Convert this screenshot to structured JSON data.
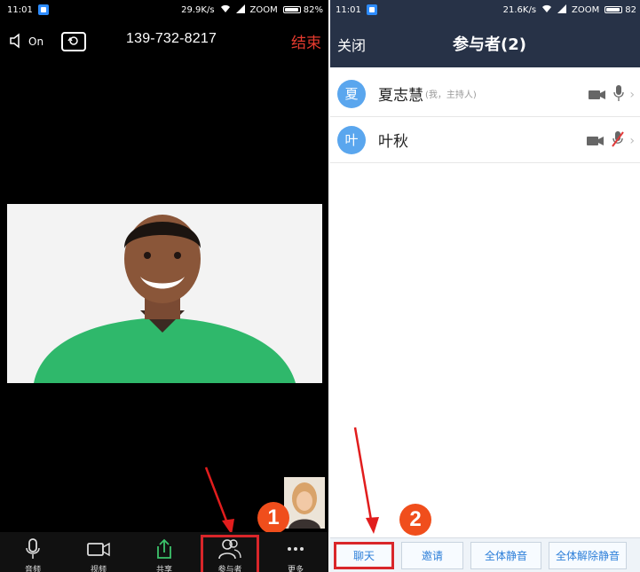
{
  "left": {
    "status": {
      "time": "11:01",
      "speed": "29.9K/s",
      "carrier": "ZOOM",
      "battery": "82%",
      "battery_level": 0.82
    },
    "toolbar": {
      "speaker_label": "On",
      "meeting_id": "139-732-8217",
      "end_label": "结束"
    },
    "bottom_tools": [
      {
        "label": "音频",
        "icon": "microphone-icon"
      },
      {
        "label": "视频",
        "icon": "video-camera-icon"
      },
      {
        "label": "共享",
        "icon": "share-upload-icon"
      },
      {
        "label": "参与者",
        "icon": "participants-icon"
      },
      {
        "label": "更多",
        "icon": "more-icon"
      }
    ],
    "step_badge": "1"
  },
  "right": {
    "status": {
      "time": "11:01",
      "speed": "21.6K/s",
      "carrier": "ZOOM",
      "battery": "82",
      "battery_level": 0.82
    },
    "header": {
      "close_label": "关闭",
      "title": "参与者(2)"
    },
    "participants": [
      {
        "initial": "夏",
        "name": "夏志慧",
        "note": "(我，主持人)",
        "muted": false
      },
      {
        "initial": "叶",
        "name": "叶秋",
        "note": "",
        "muted": true
      }
    ],
    "bottom_buttons": {
      "chat": "聊天",
      "invite": "邀请",
      "mute_all": "全体静音",
      "unmute_all": "全体解除静音"
    },
    "step_badge": "2"
  },
  "colors": {
    "accent": "#2d7fd9",
    "header": "#273247",
    "end": "#e53a2e",
    "highlight": "#d9262a",
    "badge": "#f04e1c",
    "avatar": "#5aa6ee"
  }
}
